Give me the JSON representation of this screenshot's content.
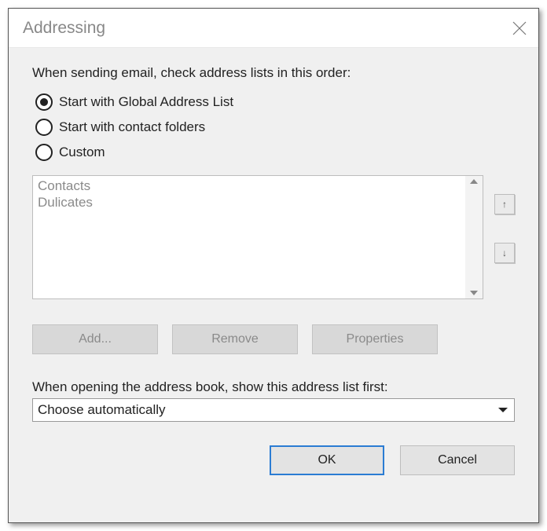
{
  "title": "Addressing",
  "heading": "When sending email, check address lists in this order:",
  "radios": {
    "gal": "Start with Global Address List",
    "contacts": "Start with contact folders",
    "custom": "Custom",
    "selected": "gal"
  },
  "list": {
    "items": [
      "Contacts",
      "Dulicates"
    ]
  },
  "list_buttons": {
    "add": "Add...",
    "remove": "Remove",
    "properties": "Properties"
  },
  "open_label": "When opening the address book, show this address list first:",
  "dropdown_value": "Choose automatically",
  "footer": {
    "ok": "OK",
    "cancel": "Cancel"
  }
}
